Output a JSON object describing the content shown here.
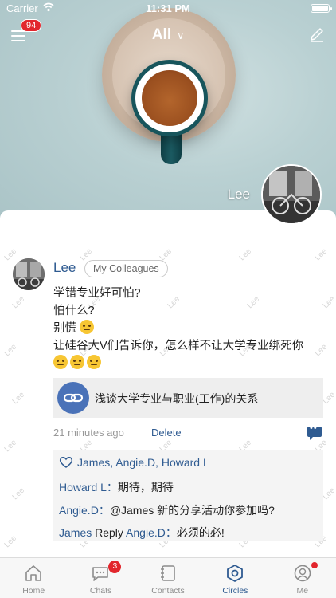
{
  "status_bar": {
    "carrier": "Carrier",
    "time": "11:31 PM"
  },
  "header": {
    "notification_count": "94",
    "title": "All",
    "chevron": "∨"
  },
  "hero": {
    "name": "Lee"
  },
  "watermark": "Lee",
  "post": {
    "author": "Lee",
    "group_tag": "My Colleagues",
    "lines": [
      "学错专业好可怕?",
      "怕什么?",
      "别慌",
      "让硅谷大V们告诉你，怎么样不让大学专业绑死你"
    ],
    "link_title": "浅谈大学专业与职业(工作)的关系",
    "time_ago": "21 minutes ago",
    "delete_label": "Delete",
    "likes": "James, Angie.D, Howard L",
    "comments": [
      {
        "author": "Howard L",
        "sep": "：",
        "text": "期待，期待"
      },
      {
        "author": "Angie.D",
        "sep": "：",
        "mention": "@James",
        "text": " 新的分享活动你参加吗?"
      },
      {
        "author": "James",
        "reply_word": " Reply ",
        "reply_to": "Angie.D",
        "sep": "：",
        "text": "必须的必!"
      }
    ]
  },
  "tabbar": {
    "tabs": [
      {
        "label": "Home"
      },
      {
        "label": "Chats",
        "badge": "3"
      },
      {
        "label": "Contacts"
      },
      {
        "label": "Circles"
      },
      {
        "label": "Me"
      }
    ],
    "active": "Circles"
  },
  "colors": {
    "accent": "#2f5b91",
    "badge": "#e2262d",
    "cup": "#17555c"
  }
}
